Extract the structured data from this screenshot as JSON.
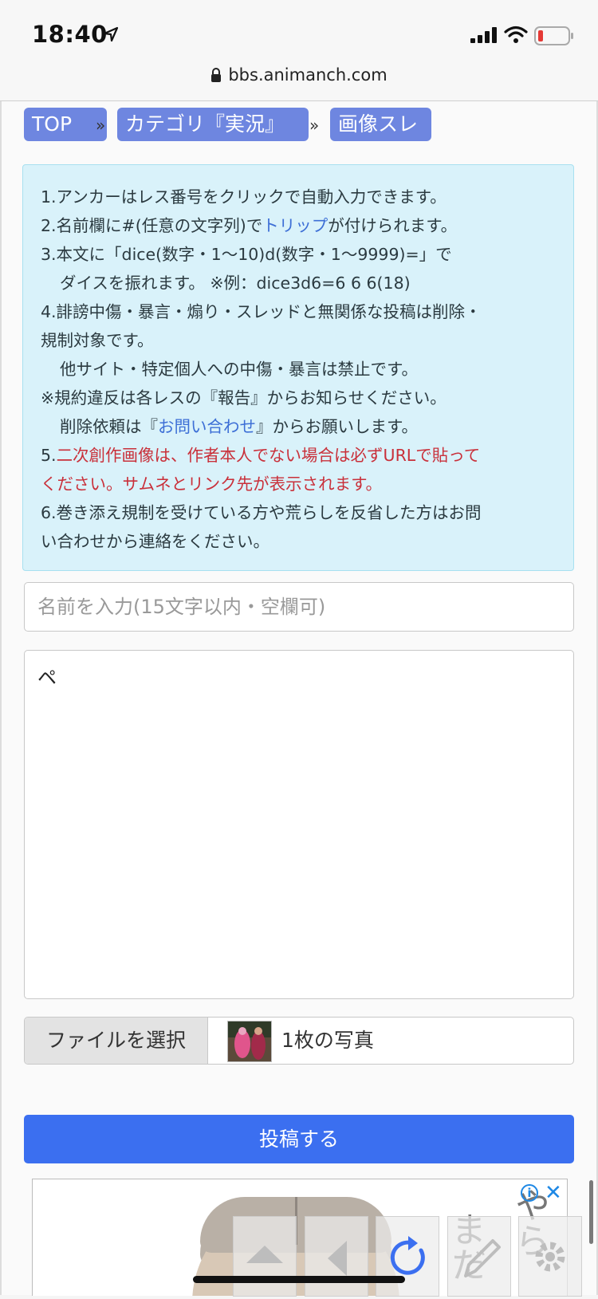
{
  "status_bar": {
    "time": "18:40"
  },
  "browser": {
    "url": "bbs.animanch.com"
  },
  "breadcrumb": {
    "items": [
      "TOP",
      "カテゴリ『実況』",
      "画像スレ"
    ],
    "separator": "»"
  },
  "notice": {
    "l1": "1.アンカーはレス番号をクリックで自動入力できます。",
    "l2a": "2.名前欄に#(任意の文字列)で",
    "l2link": "トリップ",
    "l2b": "が付けられます。",
    "l3": "3.本文に「dice(数字・1〜10)d(数字・1〜9999)=」で",
    "l3b": "ダイスを振れます。 ※例：dice3d6=6 6 6(18)",
    "l4": "4.誹謗中傷・暴言・煽り・スレッドと無関係な投稿は削除・",
    "l4b": "規制対象です。",
    "l4c": "他サイト・特定個人への中傷・暴言は禁止です。",
    "l5": "※規約違反は各レスの『報告』からお知らせください。",
    "l6a": "削除依頼は『",
    "l6link": "お問い合わせ",
    "l6b": "』からお願いします。",
    "l7prefix": "5.",
    "l7red": "二次創作画像は、作者本人でない場合は必ずURLで貼って",
    "l7red2": "ください。サムネとリンク先が表示されます。",
    "l8": "6.巻き添え規制を受けている方や荒らしを反省した方はお問",
    "l8b": "い合わせから連絡をください。"
  },
  "form": {
    "name_placeholder": "名前を入力(15文字以内・空欄可)",
    "body_value": "ペ",
    "file_button_label": "ファイルを選択",
    "file_status": "1枚の写真",
    "submit_label": "投稿する"
  },
  "ad": {
    "text_col1": "やら",
    "text_col2": "まだ"
  },
  "colors": {
    "breadcrumb": "#6e86e0",
    "notice_bg": "#d9f2fa",
    "link": "#3d6fd6",
    "warning": "#c9303a",
    "submit": "#3b6ff0"
  }
}
